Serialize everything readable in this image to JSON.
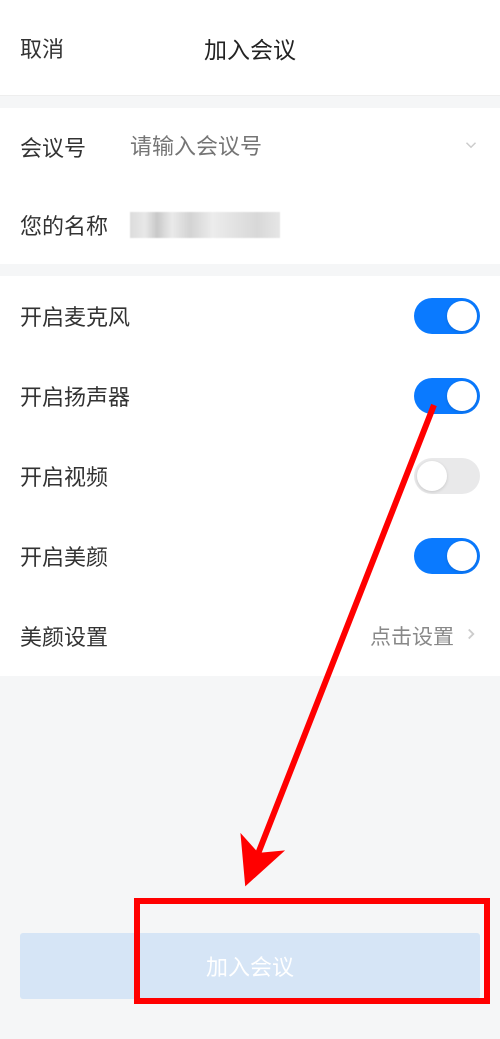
{
  "header": {
    "cancel_label": "取消",
    "title": "加入会议"
  },
  "meeting": {
    "id_label": "会议号",
    "id_placeholder": "请输入会议号",
    "name_label": "您的名称"
  },
  "options": {
    "microphone_label": "开启麦克风",
    "microphone_on": true,
    "speaker_label": "开启扬声器",
    "speaker_on": true,
    "video_label": "开启视频",
    "video_on": false,
    "beauty_label": "开启美颜",
    "beauty_on": true,
    "beauty_settings_label": "美颜设置",
    "beauty_settings_value": "点击设置"
  },
  "actions": {
    "join_label": "加入会议"
  },
  "colors": {
    "accent": "#0a7aff",
    "annotation": "#ff0000"
  }
}
